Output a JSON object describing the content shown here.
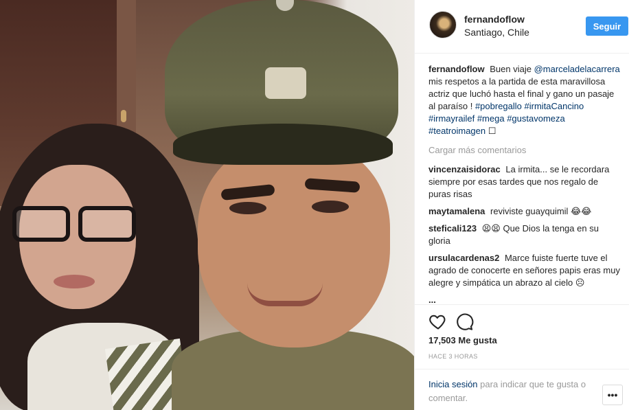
{
  "header": {
    "username": "fernandoflow",
    "location": "Santiago, Chile",
    "follow_label": "Seguir"
  },
  "caption": {
    "username": "fernandoflow",
    "text_1": "Buen viaje",
    "mention": "@marceladelacarrera",
    "text_2": "mis respetos a la partida de esta maravillosa actriz que luchó hasta el final y gano un pasaje al paraíso !",
    "hashtags": [
      "#pobregallo",
      "#irmitaCancino",
      "#irmayrailef",
      "#mega",
      "#gustavomeza",
      "#teatroimagen"
    ],
    "trailing_emoji": "☐"
  },
  "load_more_label": "Cargar más comentarios",
  "comments": [
    {
      "username": "vincenzaisidorac",
      "text": "La irmita... se le recordara siempre por esas tardes que nos regalo de puras risas"
    },
    {
      "username": "maytamalena",
      "text": "reviviste guayquimil 😂😂"
    },
    {
      "username": "steficali123",
      "text": "😫😫 Que Dios la tenga en su gloria"
    },
    {
      "username": "ursulacardenas2",
      "text": "Marce fuiste fuerte tuve el agrado de conocerte en señores papis eras muy alegre y simpática un abrazo al cielo ☹"
    },
    {
      "username": "...",
      "text": ""
    }
  ],
  "likes_text": "17,503 Me gusta",
  "time_text": "HACE 3 HORAS",
  "login": {
    "link": "Inicia sesión",
    "text": "para indicar que te gusta o comentar."
  },
  "options_label": "•••"
}
